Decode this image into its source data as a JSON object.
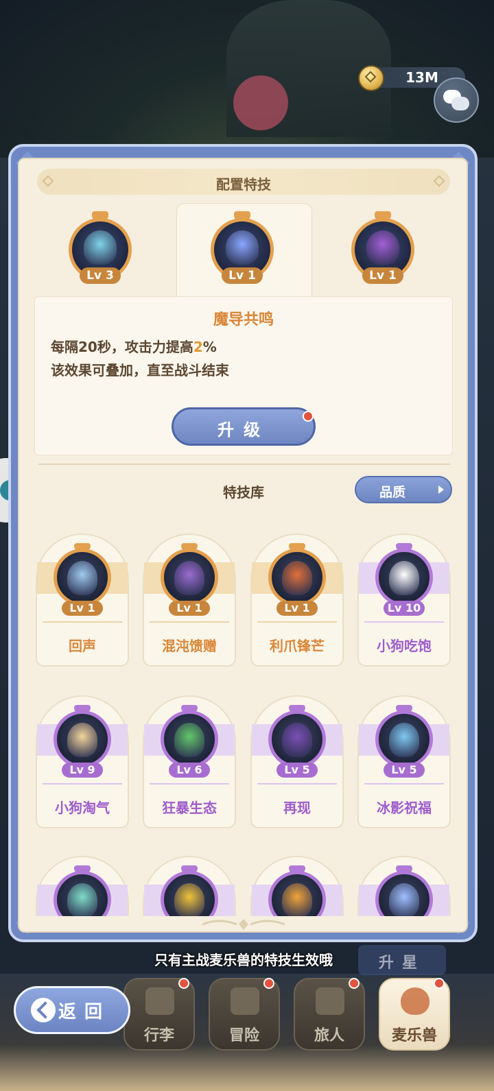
{
  "currency": {
    "value": "13M",
    "icon": "gem-coin-icon"
  },
  "panel": {
    "title": "配置特技"
  },
  "equipped": [
    {
      "level": "Lv 3",
      "color": "#7fd3e8"
    },
    {
      "level": "Lv 1",
      "color": "#8aa7ff"
    },
    {
      "level": "Lv 1",
      "color": "#a35fd6"
    }
  ],
  "selected_skill": {
    "name": "魔导共鸣",
    "desc_line1_prefix": "每隔20秒，攻击力提高",
    "desc_line1_value": "2",
    "desc_line1_suffix": "%",
    "desc_line2": "该效果可叠加，直至战斗结束"
  },
  "upgrade_label": "升级",
  "library": {
    "title": "特技库",
    "filter_label": "品质",
    "skills": [
      {
        "name": "回声",
        "level": "Lv 1",
        "tier": "gold",
        "color": "#9fc9ee"
      },
      {
        "name": "混沌馈赠",
        "level": "Lv 1",
        "tier": "gold",
        "color": "#9a6bd0"
      },
      {
        "name": "利爪锋芒",
        "level": "Lv 1",
        "tier": "gold",
        "color": "#e0703a"
      },
      {
        "name": "小狗吃饱",
        "level": "Lv 10",
        "tier": "purple",
        "color": "#ffffff"
      },
      {
        "name": "小狗淘气",
        "level": "Lv 9",
        "tier": "purple",
        "color": "#f3d49a"
      },
      {
        "name": "狂暴生态",
        "level": "Lv 6",
        "tier": "purple",
        "color": "#63c76a"
      },
      {
        "name": "再现",
        "level": "Lv 5",
        "tier": "purple",
        "color": "#7c4fb6"
      },
      {
        "name": "冰影祝福",
        "level": "Lv 5",
        "tier": "purple",
        "color": "#7fc8f0"
      },
      {
        "name": "",
        "level": "",
        "tier": "purple",
        "color": "#7fdcc8"
      },
      {
        "name": "",
        "level": "",
        "tier": "purple",
        "color": "#f1c23a"
      },
      {
        "name": "",
        "level": "",
        "tier": "purple",
        "color": "#f0a43a"
      },
      {
        "name": "",
        "level": "",
        "tier": "purple",
        "color": "#9fc0ff"
      }
    ]
  },
  "hint": "只有主战麦乐兽的特技生效哦",
  "star_label": "升星",
  "back_label": "返回",
  "nav": [
    {
      "label": "行李",
      "icon": "bag-icon",
      "active": false
    },
    {
      "label": "冒险",
      "icon": "swords-icon",
      "active": false
    },
    {
      "label": "旅人",
      "icon": "traveler-icon",
      "active": false
    },
    {
      "label": "麦乐兽",
      "icon": "fox-icon",
      "active": true
    }
  ]
}
